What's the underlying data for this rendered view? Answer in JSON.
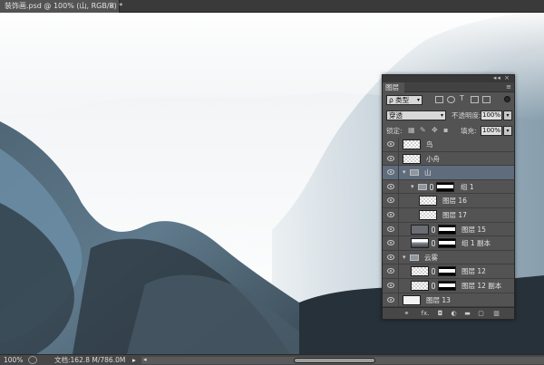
{
  "document": {
    "tab_title": "装饰画.psd @ 100% (山, RGB/8) *",
    "close_glyph": "×"
  },
  "layers_panel": {
    "panel_controls": "◂◂ ×",
    "tab_label": "图层",
    "menu_icon": "≡",
    "filter": {
      "kind": "ρ 类型",
      "dropdown": "▾",
      "icons": [
        "image-filter-icon",
        "adjustment-filter-icon",
        "type-filter-icon",
        "shape-filter-icon",
        "smart-object-filter-icon"
      ],
      "type_glyph": "T"
    },
    "blend_mode": "穿透",
    "opacity_label": "不透明度:",
    "opacity_value": "100%",
    "lock_label": "锁定:",
    "fill_label": "填充:",
    "fill_value": "100%",
    "dropdown_glyph": "▾",
    "twirl_open": "▾",
    "layers": [
      {
        "name": "鸟",
        "kind": "layer",
        "thumb": "checker",
        "indent": 0,
        "selected": false
      },
      {
        "name": "小舟",
        "kind": "layer",
        "thumb": "checker",
        "indent": 0,
        "selected": false
      },
      {
        "name": "山",
        "kind": "group",
        "indent": 0,
        "selected": true
      },
      {
        "name": "组 1",
        "kind": "group-masked",
        "indent": 1,
        "selected": false
      },
      {
        "name": "图层 16",
        "kind": "layer",
        "thumb": "checker",
        "indent": 2,
        "selected": false
      },
      {
        "name": "图层 17",
        "kind": "layer",
        "thumb": "checker",
        "indent": 2,
        "selected": false
      },
      {
        "name": "图层 15",
        "kind": "layer-masked",
        "thumb": "dark",
        "indent": 1,
        "selected": false
      },
      {
        "name": "组 1 副本",
        "kind": "layer-masked",
        "thumb": "mtn",
        "indent": 1,
        "selected": false
      },
      {
        "name": "云雾",
        "kind": "group",
        "indent": 0,
        "selected": false
      },
      {
        "name": "图层 12",
        "kind": "layer-masked",
        "thumb": "checker",
        "indent": 1,
        "selected": false
      },
      {
        "name": "图层 12 副本",
        "kind": "layer-masked",
        "thumb": "checker",
        "indent": 1,
        "selected": false
      },
      {
        "name": "图层 13",
        "kind": "layer",
        "thumb": "plain",
        "indent": 0,
        "selected": false
      }
    ],
    "bottom_icons": {
      "link": "⚭",
      "fx": "fx.",
      "mask": "◘",
      "adjust": "◐",
      "group": "▬",
      "new": "▢",
      "delete": "▥"
    }
  },
  "status_bar": {
    "zoom": "100%",
    "doc_info": "文档:162.8 M/786.0M",
    "arrow": "▸",
    "scroll_left": "◂"
  }
}
